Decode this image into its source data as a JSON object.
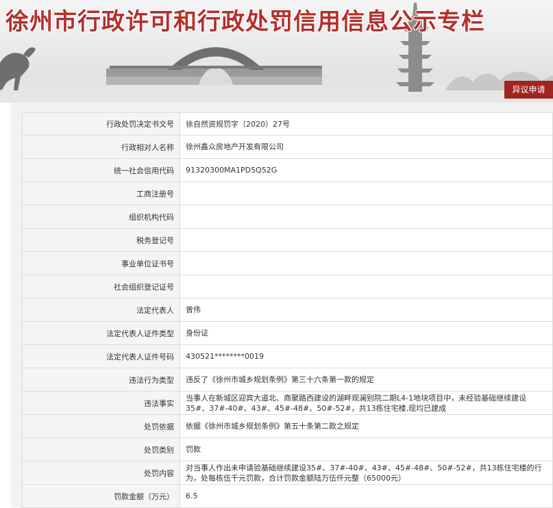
{
  "banner": {
    "title": "徐州市行政许可和行政处罚信用信息公示专栏",
    "appeal_label": "异议申请"
  },
  "colors": {
    "title_red": "#b2302c",
    "button_red": "#9e2520",
    "label_bg": "#f5f5f5",
    "border": "#dcdcdc"
  },
  "icons": [
    "horse-sculpture-art",
    "arch-bridge-art",
    "pagoda-art"
  ],
  "rows": [
    {
      "label": "行政处罚决定书文号",
      "value": "徐自然资规罚字（2020）27号"
    },
    {
      "label": "行政相对人名称",
      "value": "徐州鑫众房地产开发有限公司"
    },
    {
      "label": "统一社会信用代码",
      "value": "91320300MA1PD5Q52G"
    },
    {
      "label": "工商注册号",
      "value": ""
    },
    {
      "label": "组织机构代码",
      "value": ""
    },
    {
      "label": "税务登记号",
      "value": ""
    },
    {
      "label": "事业单位证书号",
      "value": ""
    },
    {
      "label": "社会组织登记证号",
      "value": ""
    },
    {
      "label": "法定代表人",
      "value": "曾伟"
    },
    {
      "label": "法定代表人证件类型",
      "value": "身份证"
    },
    {
      "label": "法定代表人证件号码",
      "value": "430521********0019"
    },
    {
      "label": "违法行为类型",
      "value": "违反了《徐州市城乡规划条例》第三十六条第一款的规定"
    },
    {
      "label": "违法事实",
      "value": "当事人在新城区迎宾大道北、商聚路西建设的湖畔观澜别院二期L4-1地块项目中，未经验基础继续建设35#、37#-40#、43#、45#-48#、50#-52#，共13栋住宅楼,现均已建成"
    },
    {
      "label": "处罚依据",
      "value": "依据《徐州市城乡规划条例》第五十条第二款之规定"
    },
    {
      "label": "处罚类别",
      "value": "罚款"
    },
    {
      "label": "处罚内容",
      "value": "对当事人作出未申请验基础继续建设35#、37#-40#、43#、45#-48#、50#-52#，共13栋住宅楼的行为，处每栋伍千元罚款，合计罚款金额陆万伍仟元整（65000元）"
    },
    {
      "label": "罚款金额（万元）",
      "value": "6.5"
    }
  ]
}
